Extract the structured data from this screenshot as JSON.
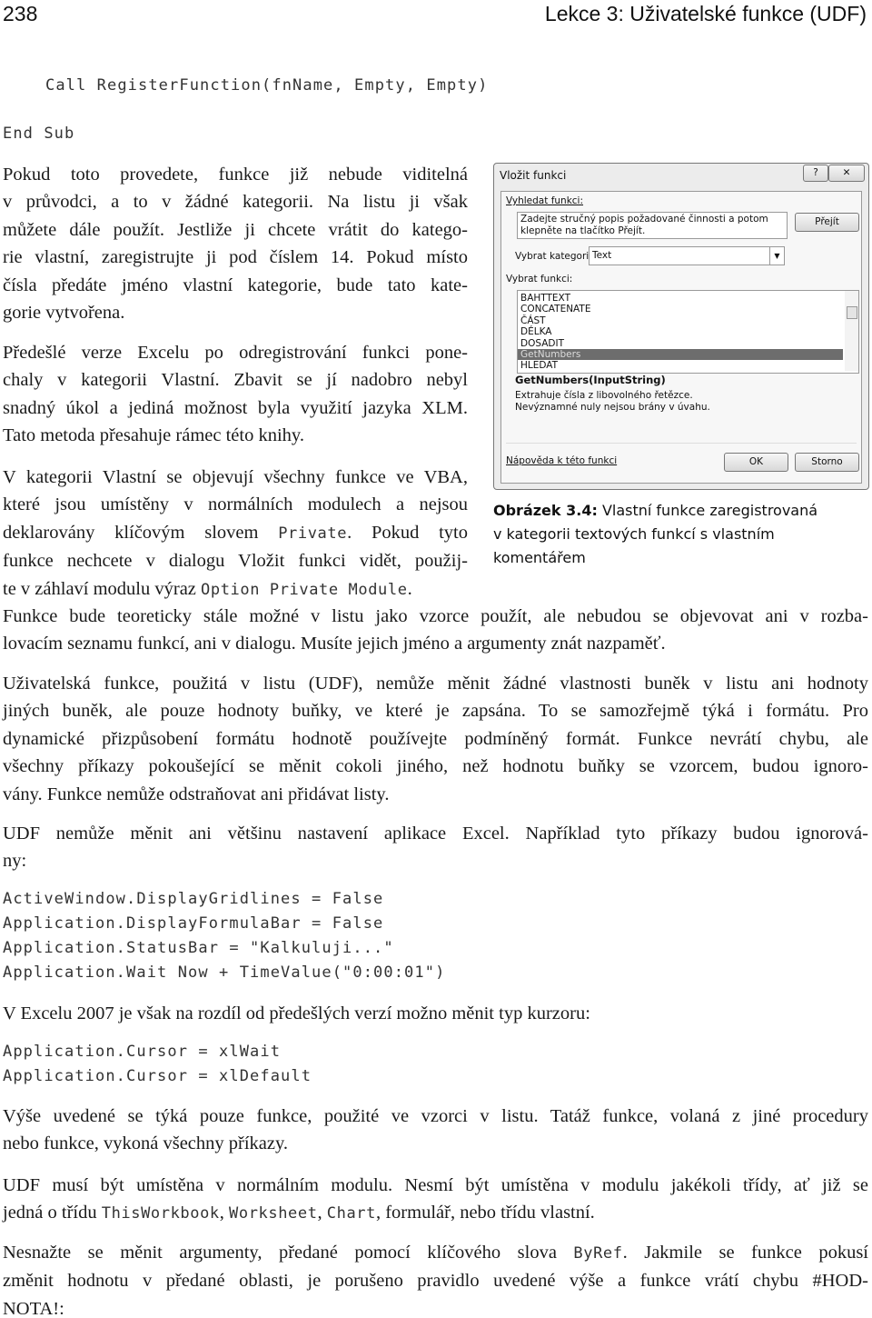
{
  "header": {
    "page_number": "238",
    "chapter_title": "Lekce 3: Uživatelské funkce (UDF)"
  },
  "code_top": [
    "Call RegisterFunction(fnName, Empty, Empty)",
    "End Sub"
  ],
  "paragraphs_left": [
    [
      [
        {
          "t": "Pokud toto provedete, funkce již nebude viditelná"
        }
      ],
      [
        {
          "t": "v průvodci, a to v žádné kategorii. Na listu ji však"
        }
      ],
      [
        {
          "t": "můžete dále použít. Jestliže ji chcete vrátit do katego-"
        }
      ],
      [
        {
          "t": "rie vlastní, zaregistrujte ji pod číslem 14. Pokud místo"
        }
      ],
      [
        {
          "t": "čísla předáte jméno vlastní kategorie, bude tato kate-"
        }
      ],
      [
        {
          "t": "gorie vytvořena."
        }
      ]
    ],
    [
      [
        {
          "t": "Předešlé verze Excelu po odregistrování funkci pone-"
        }
      ],
      [
        {
          "t": "chaly v kategorii Vlastní. Zbavit se jí nadobro nebyl"
        }
      ],
      [
        {
          "t": "snadný úkol a jediná možnost byla využití jazyka XLM."
        }
      ],
      [
        {
          "t": "Tato metoda přesahuje rámec této knihy."
        }
      ]
    ],
    [
      [
        {
          "t": "V kategorii Vlastní se objevují všechny funkce ve VBA,"
        }
      ],
      [
        {
          "t": "které jsou umístěny v normálních modulech a nejsou"
        }
      ],
      [
        {
          "t": "deklarovány klíčovým slovem "
        },
        {
          "t": "Private",
          "c": 1
        },
        {
          "t": ". Pokud tyto"
        }
      ],
      [
        {
          "t": "funkce nechcete v dialogu Vložit funkci vidět, použij-"
        }
      ],
      [
        {
          "t": "te v záhlaví modulu výraz "
        },
        {
          "t": "Option Private Module",
          "c": 1
        },
        {
          "t": "."
        }
      ]
    ]
  ],
  "paragraphs_full": [
    [
      [
        {
          "t": "Funkce bude teoreticky stále možné v listu jako vzorce použít, ale nebudou se objevovat ani v rozba-"
        }
      ],
      [
        {
          "t": "lovacím seznamu funkcí, ani v dialogu. Musíte jejich jméno a argumenty znát nazpaměť."
        }
      ]
    ],
    [
      [
        {
          "t": "Uživatelská funkce, použitá v listu (UDF), nemůže měnit žádné vlastnosti buněk v listu ani hodnoty"
        }
      ],
      [
        {
          "t": "jiných buněk, ale pouze hodnoty buňky, ve které je zapsána. To se samozřejmě týká i formátu. Pro"
        }
      ],
      [
        {
          "t": "dynamické přizpůsobení formátu hodnotě používejte podmíněný formát. Funkce nevrátí chybu, ale"
        }
      ],
      [
        {
          "t": "všechny příkazy pokoušející se měnit cokoli jiného, než hodnotu buňky se vzorcem, budou ignoro-"
        }
      ],
      [
        {
          "t": "vány. Funkce nemůže odstraňovat ani přidávat listy."
        }
      ]
    ],
    [
      [
        {
          "t": "UDF nemůže měnit ani většinu nastavení aplikace Excel. Například tyto příkazy budou ignorová-"
        }
      ],
      [
        {
          "t": "ny:"
        }
      ]
    ],
    [
      [
        {
          "t": "V Excelu 2007 je však na rozdíl od předešlých verzí možno měnit typ kurzoru:"
        }
      ]
    ],
    [
      [
        {
          "t": "Výše uvedené se týká pouze funkce, použité ve vzorci v listu. Tatáž funkce, volaná z jiné procedury"
        }
      ],
      [
        {
          "t": "nebo funkce, vykoná všechny příkazy."
        }
      ]
    ],
    [
      [
        {
          "t": "UDF musí být umístěna v normálním modulu. Nesmí být umístěna v modulu jakékoli třídy, ať již se"
        }
      ],
      [
        {
          "t": "jedná o třídu "
        },
        {
          "t": "ThisWorkbook",
          "c": 1
        },
        {
          "t": ", "
        },
        {
          "t": "Worksheet",
          "c": 1
        },
        {
          "t": ", "
        },
        {
          "t": "Chart",
          "c": 1
        },
        {
          "t": ", formulář, nebo třídu vlastní."
        }
      ]
    ],
    [
      [
        {
          "t": "Nesnažte se měnit argumenty, předané pomocí klíčového slova "
        },
        {
          "t": "ByRef",
          "c": 1
        },
        {
          "t": ". Jakmile se funkce pokusí"
        }
      ],
      [
        {
          "t": "změnit hodnotu v předané oblasti, je porušeno pravidlo uvedené výše a funkce vrátí chybu #HOD-"
        }
      ],
      [
        {
          "t": "NOTA!:"
        }
      ]
    ]
  ],
  "code_block_1": [
    "ActiveWindow.DisplayGridlines = False",
    "Application.DisplayFormulaBar = False",
    "Application.StatusBar = \"Kalkuluji...\"",
    "Application.Wait Now + TimeValue(\"0:00:01\")"
  ],
  "code_block_2": [
    "Application.Cursor = xlWait",
    "Application.Cursor = xlDefault"
  ],
  "figure": {
    "caption_label": "Obrázek 3.4:",
    "caption_lines": [
      " Vlastní funkce zaregistrovaná",
      "v kategorii textových funkcí s vlastním",
      "komentářem"
    ],
    "dialog": {
      "title": "Vložit funkci",
      "help_icon": "question-mark",
      "close_icon": "x",
      "search_label": "Vyhledat funkci:",
      "search_value": "Zadejte stručný popis požadované činnosti a potom klepněte na tlačítko Přejít.",
      "go_button": "Přejít",
      "category_label": "Vybrat kategorii:",
      "category_value": "Text",
      "function_label": "Vybrat funkci:",
      "functions": [
        "BAHTTEXT",
        "CONCATENATE",
        "ČÁST",
        "DÉLKA",
        "DOSADIT",
        "GetNumbers",
        "HLEDAT"
      ],
      "selected_function": "GetNumbers",
      "signature": "GetNumbers(InputString)",
      "description": [
        "Extrahuje čísla z libovolného řetězce.",
        "Nevýznamné nuly nejsou brány v úvahu."
      ],
      "help_link": "Nápověda k této funkci",
      "ok_button": "OK",
      "cancel_button": "Storno"
    }
  }
}
